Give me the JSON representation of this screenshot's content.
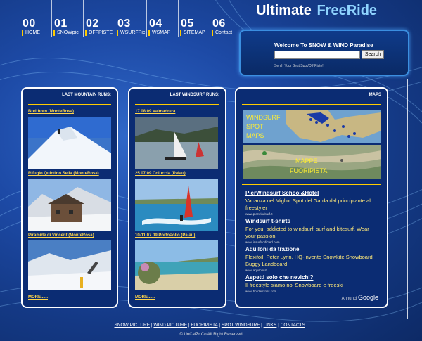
{
  "logo": {
    "part1": "Ultimate",
    "part2": "FreeRide"
  },
  "nav": [
    {
      "num": "00",
      "label": "HOME"
    },
    {
      "num": "01",
      "label": "SNOWpic"
    },
    {
      "num": "02",
      "label": "OFFPISTE"
    },
    {
      "num": "03",
      "label": "WSURFPic"
    },
    {
      "num": "04",
      "label": "WSMAP"
    },
    {
      "num": "05",
      "label": "SITEMAP"
    },
    {
      "num": "06",
      "label": "Contact"
    }
  ],
  "search": {
    "welcome": "Welcome To SNOW & WIND Paradise",
    "button": "Search",
    "hint": "Serch Your Best Spot/Off-Piste!"
  },
  "mountain": {
    "title": "LAST MOUNTAIN RUNS:",
    "items": [
      {
        "caption": "Breithorn (MonteRosa)"
      },
      {
        "caption": "Rifugio Quintino Sella (MonteRosa)"
      },
      {
        "caption": "Piramide di Vincent (MonteRosa)"
      }
    ],
    "more": "MORE......"
  },
  "windsurf": {
    "title": "LAST WINDSURF RUNS:",
    "items": [
      {
        "caption": "17.08.09 Valmadrera"
      },
      {
        "caption": "25.07.09 Coluccia (Palau)"
      },
      {
        "caption": "10-11.07.09 PortoPollo (Palau)"
      }
    ],
    "more": "MORE......"
  },
  "maps": {
    "title": "MAPS",
    "windsurf_map": [
      "WINDSURF",
      "SPOT",
      "MAPS"
    ],
    "offpiste_map": [
      "MAPPE",
      "FUORIPISTA"
    ],
    "ads": [
      {
        "title": "PierWindsurf School&Hotel",
        "text": "Vacanza nel Miglior Spot del Garda dal principiante al freestyler",
        "url": "www.pierwindsurf.it"
      },
      {
        "title": "Windsurf t-shirts",
        "text": "For you, addicted to windsurf, surf and kitesurf. Wear your passion!",
        "url": "www.insurfaddicted.com"
      },
      {
        "title": "Aquiloni da trazione",
        "text": "Flexifoil, Peter Lynn, HQ-Invento Snowkite Snowboard Buggy Landboard",
        "url": "www.aquiloni.it"
      },
      {
        "title": "Aspetti solo che nevichi?",
        "text": "Il freestyle siamo noi Snowboard e freeski",
        "url": "www.bordercross.com"
      }
    ],
    "google_prefix": "Annunci",
    "google_brand": "Google"
  },
  "footer": {
    "links": [
      "SNOW PICTURE",
      "WIND PICTURE",
      "FUORIPISTA",
      "SPOT WINDSURF",
      "LINKS",
      "CONTACTS"
    ],
    "copyright": "© UnCaIZr Co All Right Reserved"
  }
}
